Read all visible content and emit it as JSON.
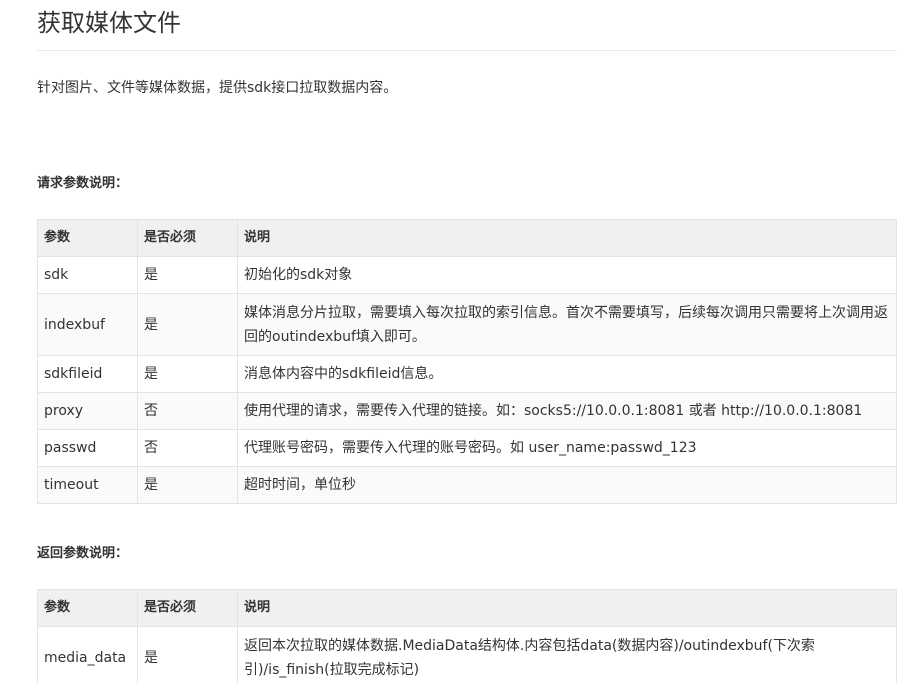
{
  "page": {
    "title": "获取媒体文件",
    "intro": "针对图片、文件等媒体数据，提供sdk接口拉取数据内容。"
  },
  "request": {
    "label": "请求参数说明：",
    "headers": [
      "参数",
      "是否必须",
      "说明"
    ],
    "rows": [
      {
        "name": "sdk",
        "required": "是",
        "desc": "初始化的sdk对象"
      },
      {
        "name": "indexbuf",
        "required": "是",
        "desc": "媒体消息分片拉取，需要填入每次拉取的索引信息。首次不需要填写，后续每次调用只需要将上次调用返回的outindexbuf填入即可。"
      },
      {
        "name": "sdkfileid",
        "required": "是",
        "desc": "消息体内容中的sdkfileid信息。"
      },
      {
        "name": "proxy",
        "required": "否",
        "desc": "使用代理的请求，需要传入代理的链接。如：socks5://10.0.0.1:8081 或者 http://10.0.0.1:8081"
      },
      {
        "name": "passwd",
        "required": "否",
        "desc": "代理账号密码，需要传入代理的账号密码。如 user_name:passwd_123"
      },
      {
        "name": "timeout",
        "required": "是",
        "desc": "超时时间，单位秒"
      }
    ]
  },
  "response": {
    "label": "返回参数说明：",
    "headers": [
      "参数",
      "是否必须",
      "说明"
    ],
    "rows": [
      {
        "name": "media_data",
        "required": "是",
        "desc": "返回本次拉取的媒体数据.MediaData结构体.内容包括data(数据内容)/outindexbuf(下次索引)/is_finish(拉取完成标记)"
      }
    ]
  }
}
